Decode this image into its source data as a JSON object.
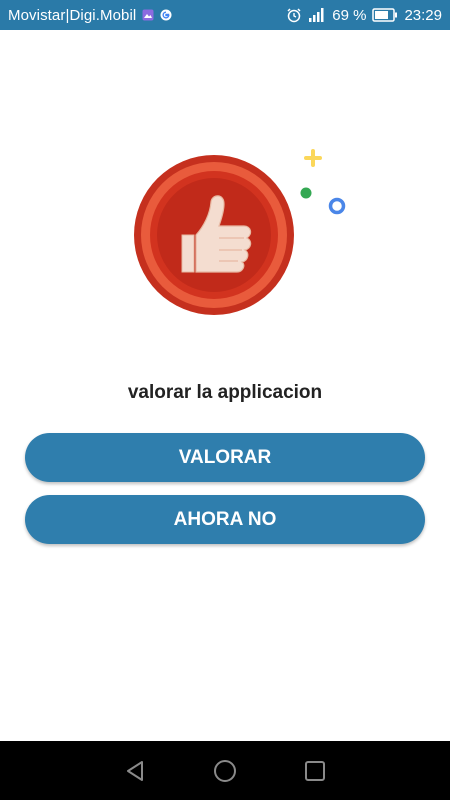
{
  "status_bar": {
    "carrier": "Movistar|Digi.Mobil",
    "battery_percent": "69 %",
    "time": "23:29",
    "icons": [
      "gallery-icon",
      "google-icon",
      "alarm-icon",
      "signal-icon",
      "battery-icon"
    ],
    "color": "#2a7aa8"
  },
  "dialog": {
    "illustration": "thumbs-up-icon",
    "title": "valorar la applicacion",
    "rate_button_label": "VALORAR",
    "later_button_label": "AHORA NO",
    "button_color": "#2f7ead"
  },
  "nav_bar": {
    "icons": [
      "back-icon",
      "home-icon",
      "recents-icon"
    ]
  }
}
